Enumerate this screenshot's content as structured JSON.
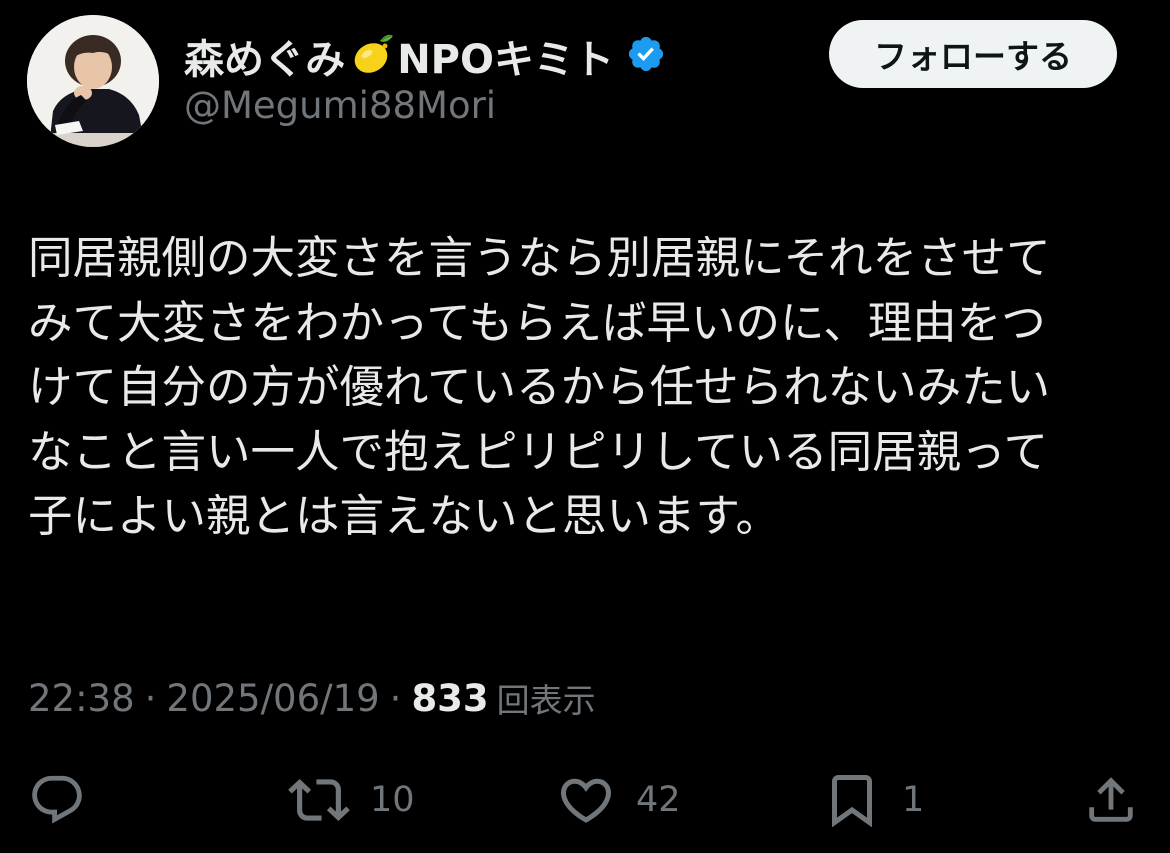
{
  "author": {
    "display_name": "森めぐみ",
    "display_name_suffix": "NPOキミト",
    "name_emoji_icon": "lemon-icon",
    "verified_icon": "verified-badge-icon",
    "handle": "@Megumi88Mori"
  },
  "follow_button": {
    "label": "フォローする"
  },
  "tweet": {
    "text": "同居親側の大変さを言うなら別居親にそれをさせて\nみて大変さをわかってもらえば早いのに、理由をつ\nけて自分の方が優れているから任せられないみたい\nなこと言い一人で抱えピリピリしている同居親って\n子によい親とは言えないと思います。"
  },
  "meta": {
    "time": "22:38",
    "separator": "·",
    "date": "2025/06/19",
    "views_count": "833",
    "views_label": "回表示"
  },
  "actions": {
    "reply": {
      "icon": "reply-icon"
    },
    "retweet": {
      "icon": "retweet-icon",
      "count": "10"
    },
    "like": {
      "icon": "heart-icon",
      "count": "42"
    },
    "bookmark": {
      "icon": "bookmark-icon",
      "count": "1"
    },
    "share": {
      "icon": "share-icon"
    }
  },
  "colors": {
    "background": "#000000",
    "primary_text": "#e7e9ea",
    "secondary_text": "#71767b",
    "verified_blue": "#1d9bf0",
    "follow_button_bg": "#eff3f4"
  }
}
